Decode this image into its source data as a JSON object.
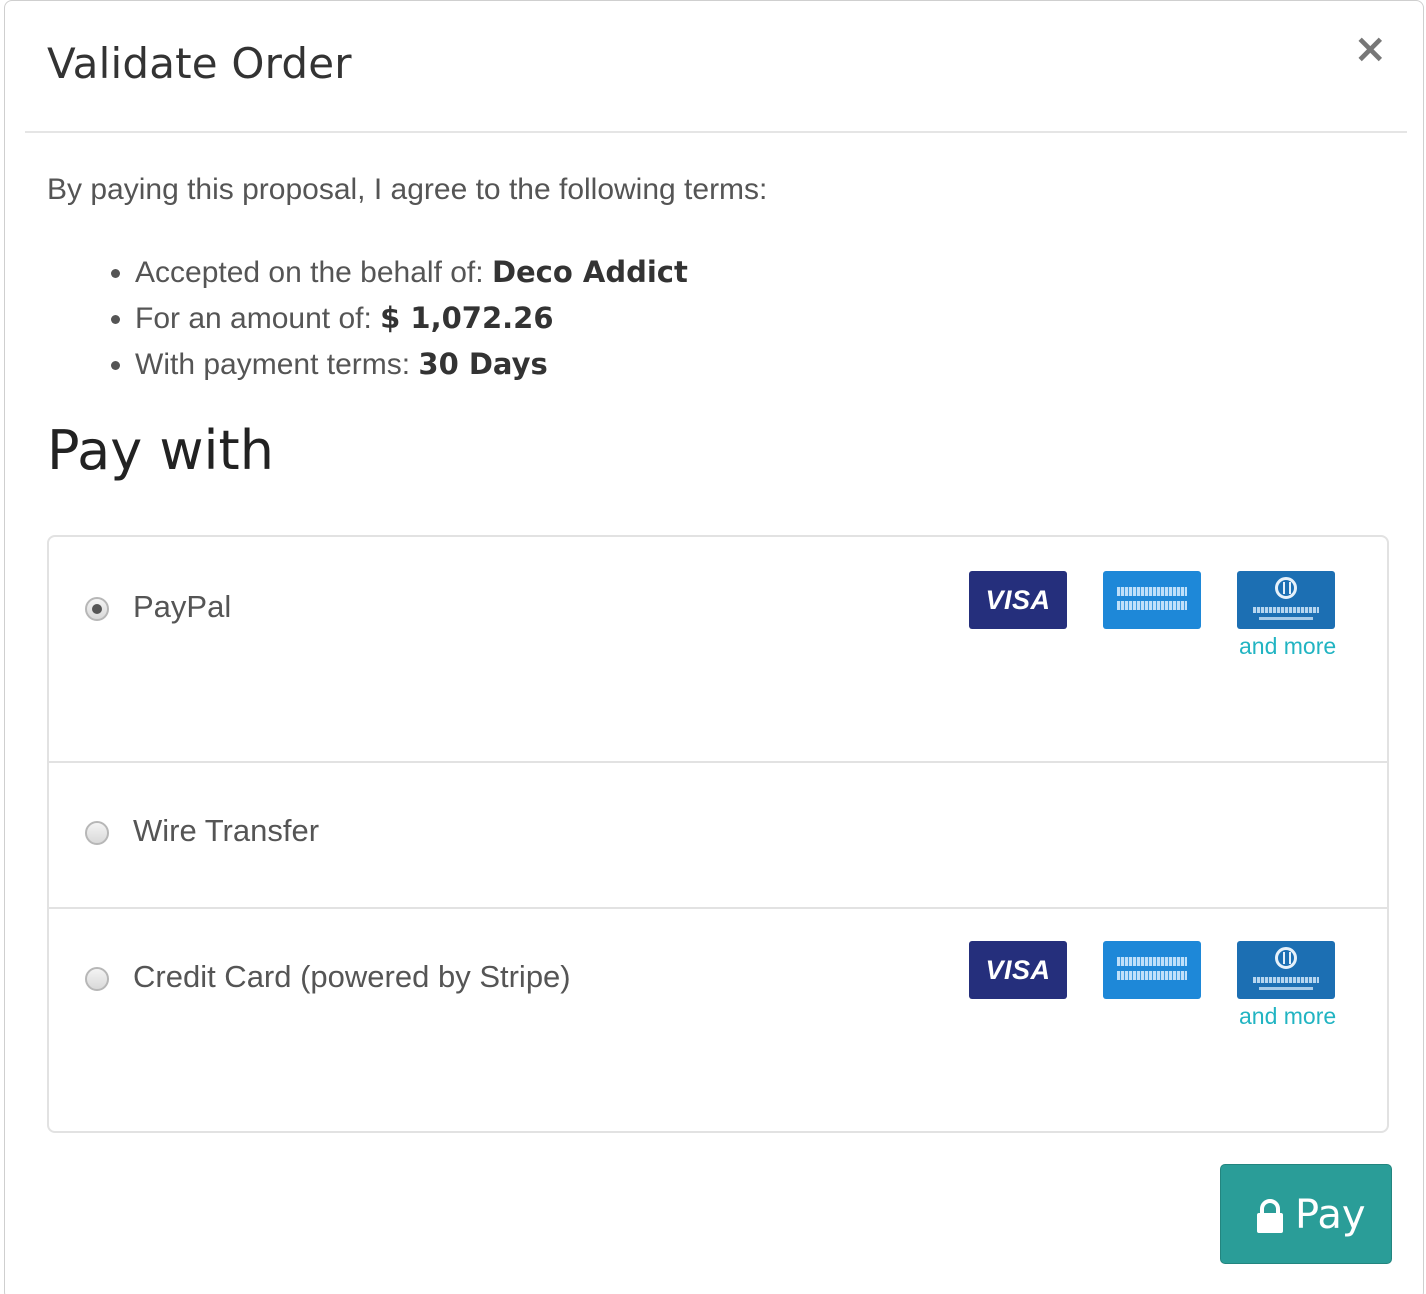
{
  "modal": {
    "title": "Validate Order",
    "close_symbol": "×"
  },
  "terms": {
    "intro": "By paying this proposal, I agree to the following terms:",
    "items": [
      {
        "label": "Accepted on the behalf of: ",
        "value": "Deco Addict"
      },
      {
        "label": "For an amount of: ",
        "value": "$ 1,072.26"
      },
      {
        "label": "With payment terms: ",
        "value": "30 Days"
      }
    ]
  },
  "pay_with": {
    "title": "Pay with",
    "methods": [
      {
        "label": "PayPal",
        "selected": true,
        "cards": [
          "visa-card-icon",
          "amex-card-icon",
          "diners-club-card-icon"
        ],
        "more": "and more"
      },
      {
        "label": "Wire Transfer",
        "selected": false
      },
      {
        "label": "Credit Card (powered by Stripe)",
        "selected": false,
        "cards": [
          "visa-card-icon",
          "amex-card-icon",
          "diners-club-card-icon"
        ],
        "more": "and more"
      }
    ],
    "visa_text": "VISA"
  },
  "pay_button": {
    "label": "Pay",
    "icon": "lock-icon",
    "color": "#2a9d98"
  },
  "colors": {
    "accent": "#2a9d98",
    "link": "#21b4c2",
    "visa": "#252f7c",
    "amex": "#1e88d8",
    "diners": "#1c6fb3"
  }
}
